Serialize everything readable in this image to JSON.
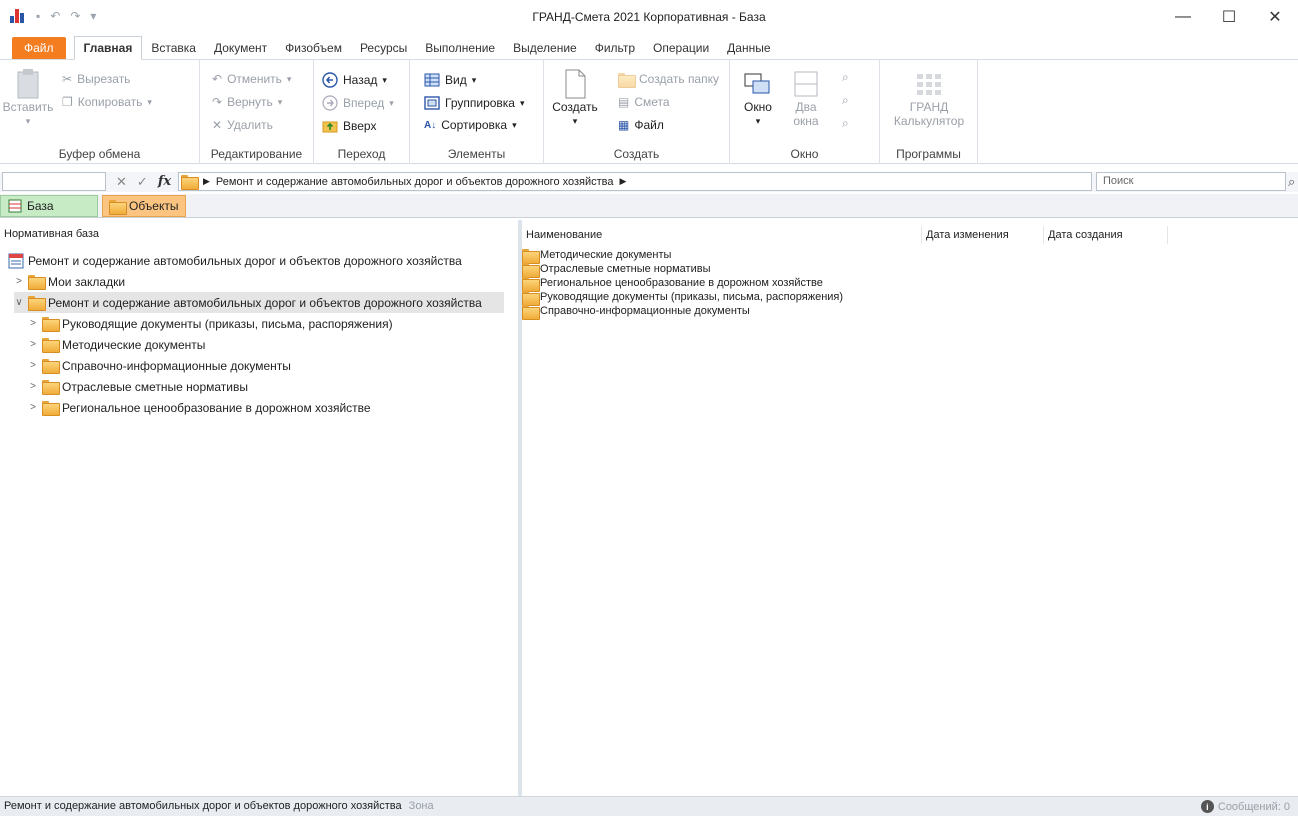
{
  "window": {
    "title": "ГРАНД-Смета 2021 Корпоративная - База",
    "minimize": "—",
    "maximize": "☐",
    "close": "✕"
  },
  "qat": {
    "undo": "↶",
    "redo": "↷",
    "save": "▪",
    "more": "▾"
  },
  "ribbon_tabs": [
    "Файл",
    "Главная",
    "Вставка",
    "Документ",
    "Физобъем",
    "Ресурсы",
    "Выполнение",
    "Выделение",
    "Фильтр",
    "Операции",
    "Данные"
  ],
  "ribbon": {
    "clipboard": {
      "label": "Буфер обмена",
      "paste": "Вставить",
      "cut": "Вырезать",
      "copy": "Копировать"
    },
    "editing": {
      "label": "Редактирование",
      "undo": "Отменить",
      "redo": "Вернуть",
      "delete": "Удалить"
    },
    "navigation": {
      "label": "Переход",
      "back": "Назад",
      "forward": "Вперед",
      "up": "Вверх"
    },
    "elements": {
      "label": "Элементы",
      "view": "Вид",
      "grouping": "Группировка",
      "sorting": "Сортировка"
    },
    "create": {
      "label": "Создать",
      "create": "Создать",
      "new_folder": "Создать папку",
      "estimate": "Смета",
      "file": "Файл"
    },
    "window": {
      "label": "Окно",
      "window": "Окно",
      "two": "Два",
      "windows": "окна"
    },
    "programs": {
      "label": "Программы",
      "grand": "ГРАНД",
      "calculator": "Калькулятор"
    }
  },
  "pathbar": {
    "path": "Ремонт и содержание автомобильных дорог и объектов дорожного хозяйства",
    "search_placeholder": "Поиск"
  },
  "doc_tabs": {
    "base": "База",
    "objects": "Объекты"
  },
  "left_panel": {
    "header": "Нормативная база",
    "tree": [
      {
        "label": "Ремонт и содержание автомобильных дорог и объектов дорожного хозяйства"
      },
      {
        "label": "Мои закладки"
      },
      {
        "label": "Ремонт и содержание автомобильных дорог и объектов дорожного хозяйства"
      },
      {
        "label": "Руководящие документы (приказы, письма, распоряжения)"
      },
      {
        "label": "Методические документы"
      },
      {
        "label": "Справочно-информационные документы"
      },
      {
        "label": "Отраслевые сметные нормативы"
      },
      {
        "label": "Региональное ценообразование в дорожном хозяйстве"
      }
    ]
  },
  "right_panel": {
    "columns": {
      "name": "Наименование",
      "modified": "Дата изменения",
      "created": "Дата создания"
    },
    "rows": [
      "Методические документы",
      "Отраслевые сметные нормативы",
      "Региональное ценообразование в дорожном хозяйстве",
      "Руководящие документы (приказы, письма, распоряжения)",
      "Справочно-информационные документы"
    ]
  },
  "status": {
    "text": "Ремонт и содержание автомобильных дорог и объектов дорожного хозяйства",
    "zone": "Зона",
    "messages": "Сообщений: 0",
    "info_icon_glyph": "i"
  },
  "colors": {
    "file_tab": "#f47d20",
    "base_tab": "#c6ebc5",
    "objects_tab": "#fbc581",
    "folder": "#f0ac3a"
  }
}
